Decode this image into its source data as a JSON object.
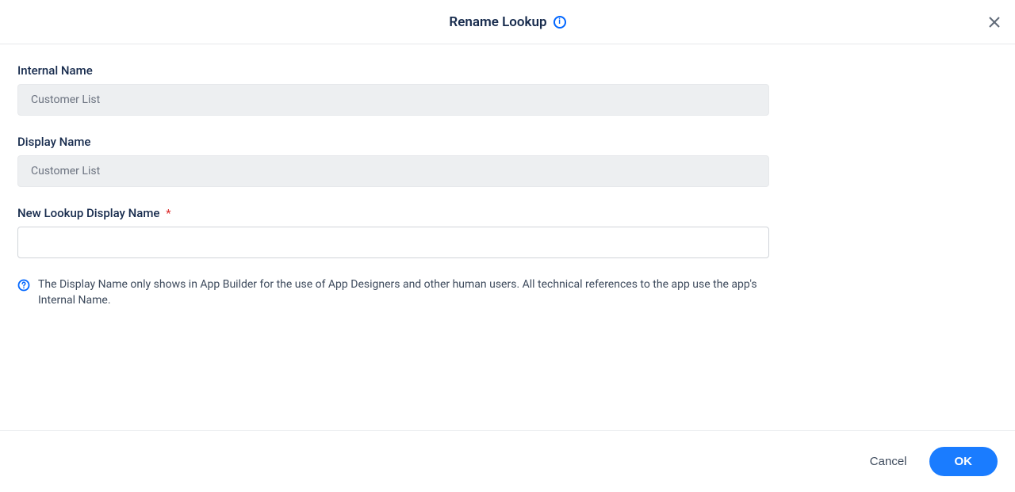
{
  "header": {
    "title": "Rename Lookup",
    "info_icon_name": "info-icon"
  },
  "fields": {
    "internal_name": {
      "label": "Internal Name",
      "value": "Customer List"
    },
    "display_name": {
      "label": "Display Name",
      "value": "Customer List"
    },
    "new_display_name": {
      "label": "New Lookup Display Name",
      "required_marker": "*",
      "value": ""
    }
  },
  "help": {
    "text": "The Display Name only shows in App Builder for the use of App Designers and other human users. All technical references to the app use the app's Internal Name."
  },
  "footer": {
    "cancel_label": "Cancel",
    "ok_label": "OK"
  }
}
